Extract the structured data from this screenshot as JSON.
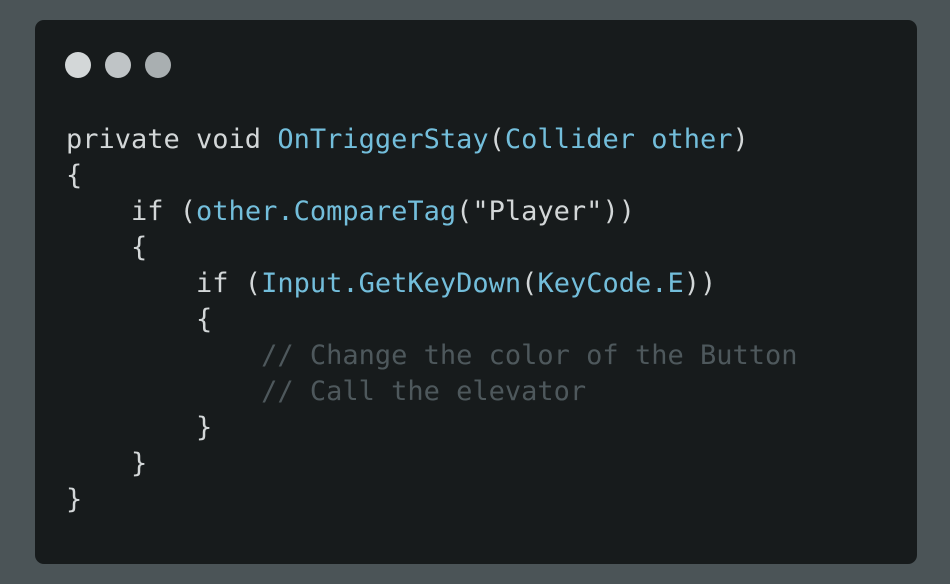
{
  "colors": {
    "background": "#4b5457",
    "window": "#171b1c",
    "dot_1": "#d3d7d8",
    "dot_2": "#bfc4c6",
    "dot_3": "#a9afb1",
    "plain": "#d3d7d8",
    "identifier": "#73bedb",
    "comment": "#4e585c"
  },
  "window_controls": [
    "dot-icon",
    "dot-icon",
    "dot-icon"
  ],
  "code_lines": [
    [
      {
        "t": "plain",
        "v": "private void "
      },
      {
        "t": "identifier",
        "v": "OnTriggerStay"
      },
      {
        "t": "plain",
        "v": "("
      },
      {
        "t": "identifier",
        "v": "Collider other"
      },
      {
        "t": "plain",
        "v": ")"
      }
    ],
    [
      {
        "t": "plain",
        "v": "{"
      }
    ],
    [
      {
        "t": "plain",
        "v": "    if ("
      },
      {
        "t": "identifier",
        "v": "other.CompareTag"
      },
      {
        "t": "plain",
        "v": "(\"Player\"))"
      }
    ],
    [
      {
        "t": "plain",
        "v": "    {"
      }
    ],
    [
      {
        "t": "plain",
        "v": "        if ("
      },
      {
        "t": "identifier",
        "v": "Input.GetKeyDown"
      },
      {
        "t": "plain",
        "v": "("
      },
      {
        "t": "identifier",
        "v": "KeyCode.E"
      },
      {
        "t": "plain",
        "v": "))"
      }
    ],
    [
      {
        "t": "plain",
        "v": "        {"
      }
    ],
    [
      {
        "t": "comment",
        "v": "            // Change the color of the Button"
      }
    ],
    [
      {
        "t": "comment",
        "v": "            // Call the elevator"
      }
    ],
    [
      {
        "t": "plain",
        "v": "        }"
      }
    ],
    [
      {
        "t": "plain",
        "v": "    }"
      }
    ],
    [
      {
        "t": "plain",
        "v": "}"
      }
    ]
  ]
}
